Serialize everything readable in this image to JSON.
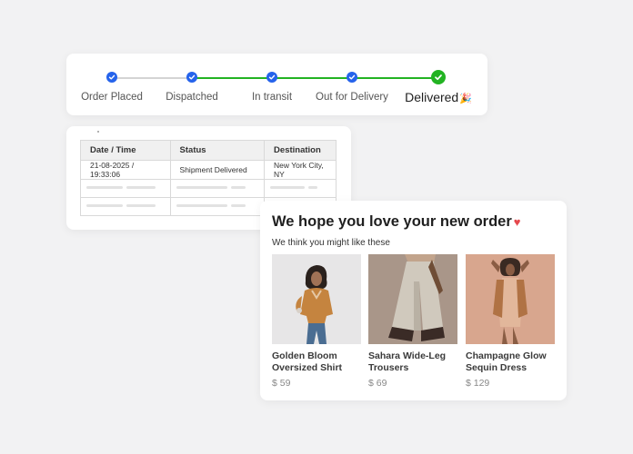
{
  "tracker": {
    "steps": [
      {
        "label": "Order Placed"
      },
      {
        "label": "Dispatched"
      },
      {
        "label": "In transit"
      },
      {
        "label": "Out for Delivery"
      },
      {
        "label": "Delivered"
      }
    ],
    "current_step": "Delivered",
    "colors": {
      "done_dot": "#2563eb",
      "final_dot": "#22b322",
      "line_gray": "#d4d4d4",
      "line_green": "#22b322"
    },
    "celebrate_icon": "party-popper-icon"
  },
  "history": {
    "columns": [
      "Date / Time",
      "Status",
      "Destination"
    ],
    "rows": [
      {
        "datetime": "21-08-2025 / 19:33:06",
        "status": "Shipment Delivered",
        "destination": "New York City, NY"
      }
    ],
    "status_color": "#16a34a"
  },
  "recommend": {
    "title": "We hope you love your new order",
    "title_icon": "heart-icon",
    "subtitle": "We think you might like these",
    "products": [
      {
        "name": "Golden Bloom Oversized Shirt",
        "price": "$ 59"
      },
      {
        "name": "Sahara Wide-Leg Trousers",
        "price": "$ 69"
      },
      {
        "name": "Champagne Glow Sequin Dress",
        "price": "$ 129"
      }
    ]
  }
}
